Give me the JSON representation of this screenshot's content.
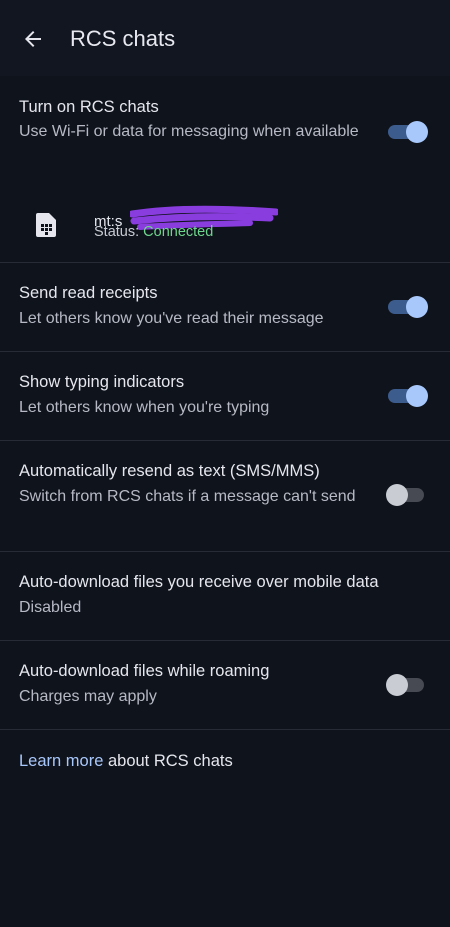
{
  "appbar": {
    "title": "RCS chats",
    "back_icon": "arrow-left-icon"
  },
  "rcs": {
    "title": "Turn on RCS chats",
    "subtitle": "Use Wi-Fi or data for messaging when available",
    "toggle_on": true
  },
  "sim": {
    "icon": "sim-card-icon",
    "number_prefix": "mt:s",
    "status_label": "Status:",
    "status_value": "Connected",
    "status_color": "#6dd58c"
  },
  "read_receipts": {
    "title": "Send read receipts",
    "subtitle": "Let others know you've read their message",
    "toggle_on": true
  },
  "typing": {
    "title": "Show typing indicators",
    "subtitle": "Let others know when you're typing",
    "toggle_on": true
  },
  "resend": {
    "title": "Automatically resend as text (SMS/MMS)",
    "subtitle": "Switch from RCS chats if a message can't send",
    "toggle_on": false
  },
  "autodl_mobile": {
    "title": "Auto-download files you receive over mobile data",
    "subtitle": "Disabled"
  },
  "autodl_roaming": {
    "title": "Auto-download files while roaming",
    "subtitle": "Charges may apply",
    "toggle_on": false
  },
  "footer": {
    "link_text": "Learn more",
    "rest_text": " about RCS chats"
  },
  "colors": {
    "background": "#0f131c",
    "accent": "#a8c7fa",
    "toggle_on_track": "#3c5c8e",
    "redaction": "#8a3ddf"
  }
}
